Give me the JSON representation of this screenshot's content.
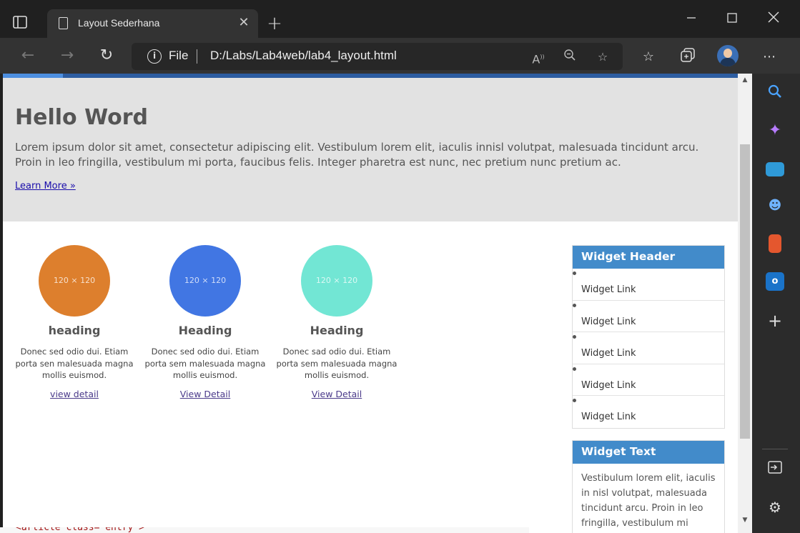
{
  "browser": {
    "tab_title": "Layout Sederhana",
    "address_protocol": "File",
    "address_url": "D:/Labs/Lab4web/lab4_layout.html"
  },
  "page": {
    "hero": {
      "title": "Hello Word",
      "text": "Lorem ipsum dolor sit amet, consectetur adipiscing elit. Vestibulum lorem elit, iaculis innisl volutpat, malesuada tincidunt arcu. Proin in leo fringilla, vestibulum mi porta, faucibus felis. Integer pharetra est nunc, nec pretium nunc pretium ac.",
      "link": "Learn More »"
    },
    "cards": [
      {
        "image_label": "120 × 120",
        "color": "#dd7f2d",
        "heading": "heading",
        "text": "Donec sed odio dui. Etiam porta sen malesuada magna mollis euismod.",
        "link": "view detail"
      },
      {
        "image_label": "120 × 120",
        "color": "#4176e3",
        "heading": "Heading",
        "text": "Donec sed odio dui. Etiam porta sem malesuada magna mollis euismod.",
        "link": "View Detail"
      },
      {
        "image_label": "120 × 120",
        "color": "#72e6d4",
        "heading": "Heading",
        "text": "Donec sad odio dui. Etiam porta sem malesuada magna mollis euismod.",
        "link": "View Detail"
      }
    ],
    "widget_links": {
      "header": "Widget Header",
      "items": [
        "Widget Link",
        "Widget Link",
        "Widget Link",
        "Widget Link",
        "Widget Link"
      ]
    },
    "widget_text": {
      "header": "Widget Text",
      "text": "Vestibulum lorem elit, iaculis in nisl volutpat, malesuada tincidunt arcu. Proin in leo fringilla, vestibulum mi porta,"
    },
    "code_peek": "<article class=\"entry\">"
  },
  "colors": {
    "widget_header": "#428bca",
    "hero_bg": "#e2e2e2",
    "browser_bg": "#202020"
  }
}
